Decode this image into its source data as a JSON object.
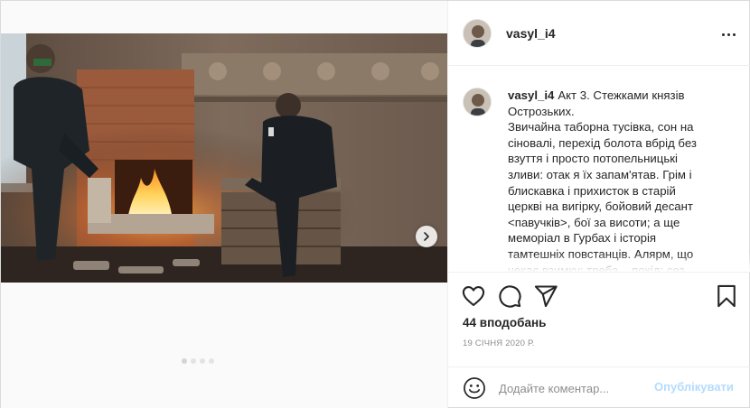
{
  "user": {
    "username": "vasyl_i4"
  },
  "caption": {
    "username": "vasyl_i4",
    "text": "Акт 3. Стежками князів\nОстрозьких.\nЗвичайна таборна тусівка, сон на\nсіновалі, перехід болота вбрід без\nвзуття і просто потопельницькі\nзливи: отак я їх запам'ятав. Грім і\nблискавка і прихисток в старій\nцеркві на вигірку, бойовий десант\n<павучків>, бої за висоти; а ще\nмеморіал в Гурбах і історія\nтамтешніх повстанців. Алярм, що\nчекає взимку: треба... похід; сез"
  },
  "likes": "44 вподобань",
  "date": "19 січня 2020 р.",
  "comment_box": {
    "placeholder": "Додайте коментар...",
    "post_label": "Опублікувати"
  },
  "carousel": {
    "count": 4,
    "active": 0
  },
  "icons": [
    "more-options-icon",
    "chevron-right-icon",
    "heart-icon",
    "comment-bubble-icon",
    "paper-plane-icon",
    "bookmark-icon",
    "smiley-icon"
  ],
  "colors": {
    "text": "#262626",
    "secondary": "#8e8e8e",
    "border": "#dbdbdb",
    "post_button_disabled": "#b3dbff"
  }
}
